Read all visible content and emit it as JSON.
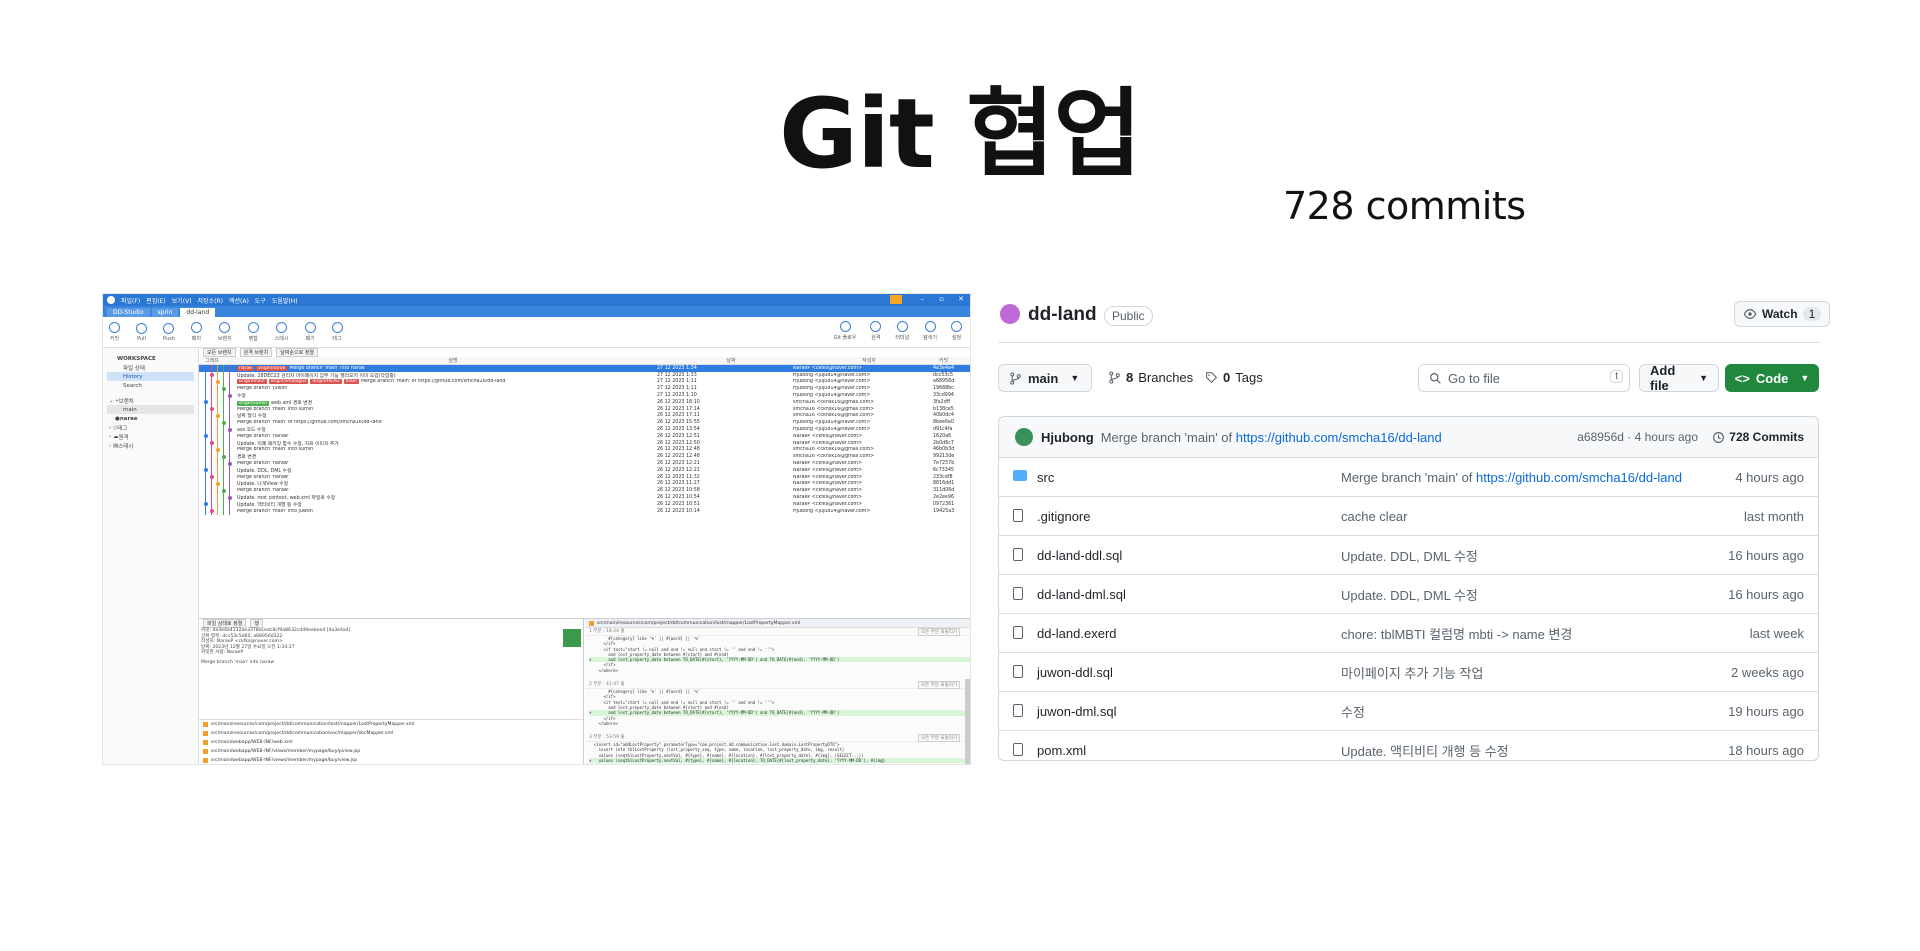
{
  "slide": {
    "title": "Git 협업",
    "commit_note": "728 commits"
  },
  "sourcetree": {
    "menu": [
      "파일(F)",
      "편집(E)",
      "보기(V)",
      "저장소(R)",
      "액션(A)",
      "도구",
      "도움말(H)"
    ],
    "tabs": [
      "DD-Studio",
      "sprin",
      "dd-land"
    ],
    "toolbar": [
      "커밋",
      "Pull",
      "Push",
      "패치",
      "브랜치",
      "병합",
      "스태시",
      "폐기",
      "태그"
    ],
    "toolbar_right": [
      "Git 플로우",
      "원격",
      "터미널",
      "탐색기",
      "설정"
    ],
    "sidebar": {
      "workspace": "WORKSPACE",
      "items": [
        "파일 상태",
        "History",
        "Search"
      ],
      "branches_label": "브랜치",
      "branches": [
        "main",
        "narae"
      ],
      "tags_label": "태그",
      "remotes_label": "원격",
      "stash_label": "스태시"
    },
    "filters": [
      "모든 브랜치",
      "원격 브랜치",
      "날짜순으로 정렬"
    ],
    "columns": [
      "그래프",
      "설명",
      "날짜",
      "작성자",
      "커밋"
    ],
    "commits": [
      {
        "msg": "Merge branch 'main' into narae",
        "date": "27 12 2023 1:34",
        "author": "NaraeP <ckfks@naver.com>",
        "hash": "4a3e4a4",
        "sel": true,
        "tags": [
          {
            "t": "narae",
            "c": "red"
          },
          {
            "t": "origin/narae",
            "c": "red"
          }
        ]
      },
      {
        "msg": "Update. 28DEC23 관리자 마이페이지 갑부 기능 헬리오치 이미 도입(작업중)",
        "date": "27 12 2023 1:33",
        "author": "Hjubong <jujud14@naver.com>",
        "hash": "dcc53c5",
        "tags": []
      },
      {
        "msg": "Merge branch 'main' of https://github.com/smcha16/dd-land",
        "date": "27 12 2023 1:11",
        "author": "Hjubong <jujud14@naver.com>",
        "hash": "a68956d",
        "tags": [
          {
            "t": "origin/main",
            "c": "red"
          },
          {
            "t": "origin/smalogus",
            "c": "red"
          },
          {
            "t": "origin/HEAD",
            "c": "red"
          },
          {
            "t": "main",
            "c": "red"
          }
        ]
      },
      {
        "msg": "Merge branch 'juwon'",
        "date": "27 12 2023 1:11",
        "author": "Hjubong <jujud14@naver.com>",
        "hash": "19688bc",
        "tags": []
      },
      {
        "msg": "수정",
        "date": "27 12 2023 1:10",
        "author": "Hjubong <jujud14@naver.com>",
        "hash": "33cd994",
        "tags": []
      },
      {
        "msg": "web.xml 경로 변경",
        "date": "26 12 2023 18:10",
        "author": "smcha16 <ckhsk16@gmail.com>",
        "hash": "3fa2dff",
        "tags": [
          {
            "t": "origin/sumin",
            "c": "green"
          }
        ]
      },
      {
        "msg": "Merge branch 'main' into sumin",
        "date": "26 12 2023 17:14",
        "author": "smcha16 <ckhsk16@gmail.com>",
        "hash": "b138ce5",
        "tags": []
      },
      {
        "msg": "날짜 형식 수정",
        "date": "26 12 2023 17:11",
        "author": "smcha16 <ckhsk16@gmail.com>",
        "hash": "40b0dc4",
        "tags": []
      },
      {
        "msg": "Merge branch 'main' of https://github.com/smcha16/dd-land",
        "date": "26 12 2023 15:55",
        "author": "Hjubong <jujud14@naver.com>",
        "hash": "8bee6e0",
        "tags": []
      },
      {
        "msg": "ass 코드 수정",
        "date": "26 12 2023 13:54",
        "author": "Hjubong <jujud14@naver.com>",
        "hash": "d91c4fa",
        "tags": []
      },
      {
        "msg": "Merge branch 'naraw'",
        "date": "26 12 2023 12:51",
        "author": "NaraeP <ckfks@naver.com>",
        "hash": "1620a6",
        "tags": []
      },
      {
        "msg": "Update. 지폐 패키징 함수 수정, 지프 이미지 추가",
        "date": "26 12 2023 12:50",
        "author": "NaraeP <ckfks@naver.com>",
        "hash": "2b0d6c7",
        "tags": []
      },
      {
        "msg": "Merge branch 'main' into sumin",
        "date": "26 12 2023 12:48",
        "author": "smcha16 <ckhsk16@gmail.com>",
        "hash": "46b0b3d",
        "tags": []
      },
      {
        "msg": "경로 변경",
        "date": "26 12 2023 12:48",
        "author": "smcha16 <ckhsk16@gmail.com>",
        "hash": "99213de",
        "tags": []
      },
      {
        "msg": "Merge branch 'naraw'",
        "date": "26 12 2023 12:21",
        "author": "NaraeP <ckfks@naver.com>",
        "hash": "7e7257b",
        "tags": []
      },
      {
        "msg": "Update. DDL, DML 수정",
        "date": "26 12 2023 12:21",
        "author": "NaraeP <ckfks@naver.com>",
        "hash": "6c73345",
        "tags": []
      },
      {
        "msg": "Merge branch 'naraw'",
        "date": "26 12 2023 11:32",
        "author": "NaraeP <ckfks@naver.com>",
        "hash": "233cdf8",
        "tags": []
      },
      {
        "msg": "Update. 나개View 수정",
        "date": "26 12 2023 11:27",
        "author": "NaraeP <ckfks@naver.com>",
        "hash": "8816dd1",
        "tags": []
      },
      {
        "msg": "Merge branch 'naraw'",
        "date": "26 12 2023 10:58",
        "author": "NaraeP <ckfks@naver.com>",
        "hash": "311d06d",
        "tags": []
      },
      {
        "msg": "Update. root context, web.xml 파일로 수정",
        "date": "26 12 2023 10:54",
        "author": "NaraeP <ckfks@naver.com>",
        "hash": "2e2ee96",
        "tags": []
      },
      {
        "msg": "Update. 액티비티 개행 등 수정",
        "date": "26 12 2023 10:51",
        "author": "NaraeP <ckfks@naver.com>",
        "hash": "0972361",
        "tags": []
      },
      {
        "msg": "Merge branch 'main' into juwon",
        "date": "26 12 2023 10:14",
        "author": "Hjubong <jujud14@naver.com>",
        "hash": "19425a3",
        "tags": []
      }
    ],
    "bottom_toolbar": [
      "파일 상태로 정렬",
      "행"
    ],
    "commit_info": [
      "커밋: 4a3e4a4132ae3378ecedc8cf9a8632cd49eabee4 [4a3e4a4]",
      "상위 항목: dcc53c5d60, a68956d322",
      "작성자: NaraeP <ckfks@naver.com>",
      "날짜: 2023년 12월 27일 수요일 오전 1:34:27",
      "커밋한 사람: NaraeP"
    ],
    "commit_msg": "Merge branch 'main' into naraw",
    "changed_files": [
      "src/main/resources/com/project/dd/communication/lost/mapper/LostPropertyMapper.xml",
      "src/main/resources/com/project/dd/communication/voc/mapper/VocMapper.xml",
      "src/main/webapp/WEB-INF/web.xml",
      "src/main/webapp/WEB-INF/views/member/mypage/buy/pview.jsp",
      "src/main/webapp/WEB-INF/views/member/mypage/buy/view.jsp",
      "src/main/webapp/WEB-INF/views/member/mypage/review/view.jsp"
    ],
    "diff_file": "src/main/resources/com/project/dd/communication/lost/mapper/LostPropertyMapper.xml",
    "hunk_labels": [
      "1 부분 : 18-24 줄",
      "2 부분 : 41-47 줄",
      "3 부분 : 53-59 줄"
    ],
    "hunk_action": "모든 부분 되돌리기",
    "code_hunk1": [
      "        #{category} like '%' || #{word} || '%'",
      "      </if>",
      "      <if test=\"start != null and end != null and start != '' and end != ''\">",
      "        and lost_property_date between #{start} and #{end}",
      "+       and lost_property_date between TO_DATE(#{start}, 'YYYY-MM-DD') and TO_DATE(#{end}, 'YYYY-MM-DD')",
      "      </if>",
      "    </where>"
    ],
    "code_hunk2": [
      "        #{category} like '%' || #{word} || '%'",
      "      </if>",
      "      <if test=\"start != null and end != null and start != '' and end != ''\">",
      "        and lost_property_date between #{start} and #{end}",
      "+       and lost_property_date between TO_DATE(#{start}, 'YYYY-MM-DD') and TO_DATE(#{end}, 'YYYY-MM-DD')",
      "      </if>",
      "    </where>"
    ],
    "code_hunk3": [
      "  <insert id=\"addLostProperty\" parameterType=\"com.project.dd.communication.lost.domain.LostPropertyDTO\">",
      "    insert into tblLostProperty (lost_property_seq, type, name, location, lost_property_date, img, result)",
      "    values (seqtblLostProperty.nextVal, #{type}, #{name}, #{location}, #{lost_property_date}, #{img}, (SELECT...))",
      "+   values (seqtblLostProperty.nextVal, #{type}, #{name}, #{location}, TO_DATE(#{lost_property_date}, 'YYYY-MM-DD'), #{img}",
      "  </insert>"
    ]
  },
  "github": {
    "repo_name": "dd-land",
    "visibility": "Public",
    "watch_label": "Watch",
    "watch_count": "1",
    "branch": "main",
    "branches_count": "8",
    "branches_label": "Branches",
    "tags_count": "0",
    "tags_label": "Tags",
    "search_placeholder": "Go to file",
    "search_key": "t",
    "add_file_label": "Add file",
    "code_label": "Code",
    "latest_commit": {
      "author": "Hjubong",
      "message": "Merge branch 'main' of",
      "link": "https://github.com/smcha16/dd-land",
      "meta": "a68956d · 4 hours ago",
      "count": "728 Commits"
    },
    "files": [
      {
        "type": "folder",
        "name": "src",
        "message": "Merge branch 'main' of",
        "link": "https://github.com/smcha16/dd-land",
        "time": "4 hours ago"
      },
      {
        "type": "file",
        "name": ".gitignore",
        "message": "cache clear",
        "link": "",
        "time": "last month"
      },
      {
        "type": "file",
        "name": "dd-land-ddl.sql",
        "message": "Update. DDL, DML 수정",
        "link": "",
        "time": "16 hours ago"
      },
      {
        "type": "file",
        "name": "dd-land-dml.sql",
        "message": "Update. DDL, DML 수정",
        "link": "",
        "time": "16 hours ago"
      },
      {
        "type": "file",
        "name": "dd-land.exerd",
        "message": "chore: tblMBTI 컬럼명 mbti -> name 변경",
        "link": "",
        "time": "last week"
      },
      {
        "type": "file",
        "name": "juwon-ddl.sql",
        "message": "마이페이지 추가 기능 작업",
        "link": "",
        "time": "2 weeks ago"
      },
      {
        "type": "file",
        "name": "juwon-dml.sql",
        "message": "수정",
        "link": "",
        "time": "19 hours ago"
      },
      {
        "type": "file",
        "name": "pom.xml",
        "message": "Update. 액티비티 개행 등 수정",
        "link": "",
        "time": "18 hours ago"
      }
    ]
  }
}
